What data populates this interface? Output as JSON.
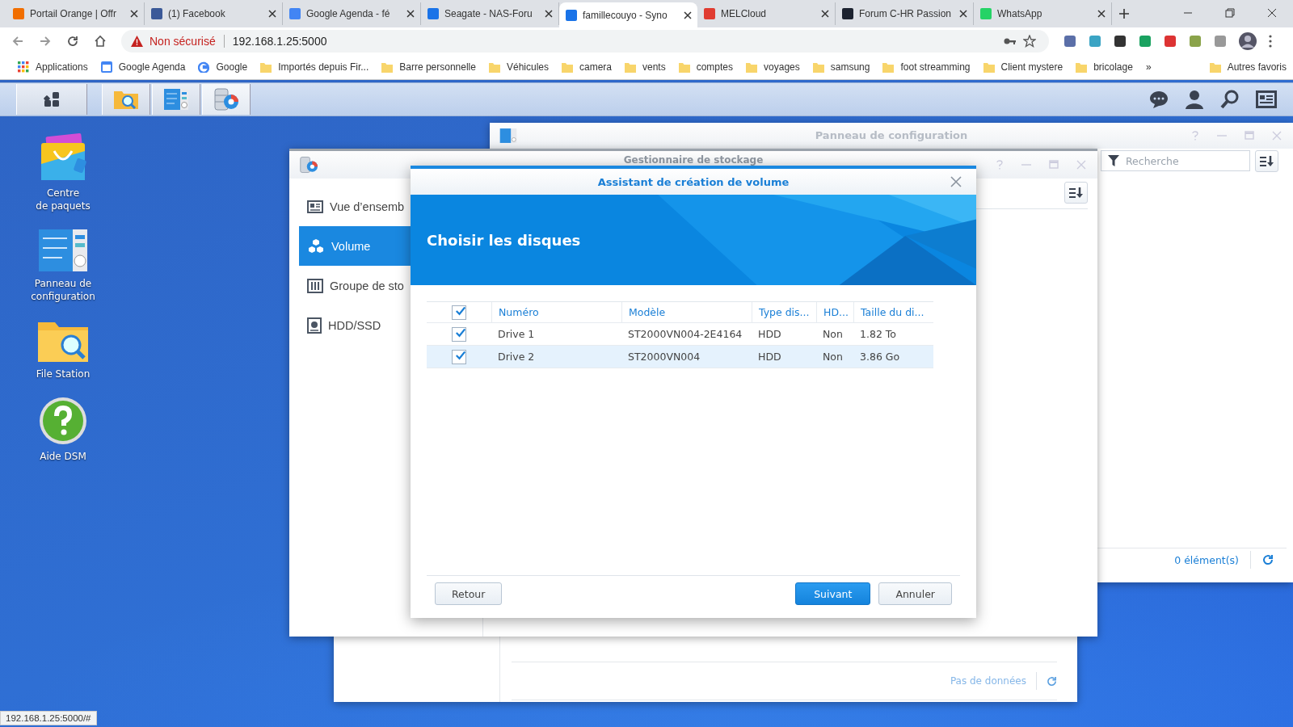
{
  "browser": {
    "tabs": [
      {
        "label": "Portail Orange | Offr",
        "selected": false
      },
      {
        "label": "(1) Facebook",
        "selected": false
      },
      {
        "label": "Google Agenda - fé",
        "selected": false
      },
      {
        "label": "Seagate - NAS-Foru",
        "selected": false
      },
      {
        "label": "famillecouyo - Syno",
        "selected": true
      },
      {
        "label": "MELCloud",
        "selected": false
      },
      {
        "label": "Forum C-HR Passion",
        "selected": false
      },
      {
        "label": "WhatsApp",
        "selected": false
      }
    ],
    "security": "Non sécurisé",
    "url": "192.168.1.25:5000",
    "bookmarks": [
      {
        "label": "Applications",
        "kind": "apps"
      },
      {
        "label": "Google Agenda",
        "kind": "calendar"
      },
      {
        "label": "Google",
        "kind": "google"
      },
      {
        "label": "Importés depuis Fir...",
        "kind": "folder"
      },
      {
        "label": "Barre personnelle",
        "kind": "folder"
      },
      {
        "label": "Véhicules",
        "kind": "folder"
      },
      {
        "label": "camera",
        "kind": "folder"
      },
      {
        "label": "vents",
        "kind": "folder"
      },
      {
        "label": "comptes",
        "kind": "folder"
      },
      {
        "label": "voyages",
        "kind": "folder"
      },
      {
        "label": "samsung",
        "kind": "folder"
      },
      {
        "label": "foot streamming",
        "kind": "folder"
      },
      {
        "label": "Client mystere",
        "kind": "folder"
      },
      {
        "label": "bricolage",
        "kind": "folder"
      },
      {
        "label": "»",
        "kind": "more"
      },
      {
        "label": "Autres favoris",
        "kind": "folder"
      }
    ],
    "status_url": "192.168.1.25:5000/#"
  },
  "desktop_icons": [
    {
      "label": "Centre\nde paquets"
    },
    {
      "label": "Panneau de\nconfiguration"
    },
    {
      "label": "File Station"
    },
    {
      "label": "Aide DSM"
    }
  ],
  "control_panel": {
    "title": "Panneau de configuration",
    "search": {
      "placeholder": "Recherche"
    },
    "count": "0 élément(s)"
  },
  "back_window": {
    "empty": "Pas de données"
  },
  "storage_manager": {
    "title": "Gestionnaire de stockage",
    "sidebar": [
      {
        "label": "Vue d’ensemb",
        "selected": false
      },
      {
        "label": "Volume",
        "selected": true
      },
      {
        "label": "Groupe de sto",
        "selected": false
      },
      {
        "label": "HDD/SSD",
        "selected": false
      }
    ]
  },
  "wizard": {
    "title": "Assistant de création de volume",
    "heading": "Choisir les disques",
    "all_checked": true,
    "columns": [
      "Numéro",
      "Modèle",
      "Type dis...",
      "HD...",
      "Taille du di..."
    ],
    "rows": [
      {
        "checked": true,
        "selected": false,
        "cells": [
          "Drive 1",
          "ST2000VN004-2E4164",
          "HDD",
          "Non",
          "1.82 To"
        ]
      },
      {
        "checked": true,
        "selected": true,
        "cells": [
          "Drive 2",
          "ST2000VN004",
          "HDD",
          "Non",
          "3.86 Go"
        ]
      }
    ],
    "buttons": {
      "back": "Retour",
      "next": "Suivant",
      "cancel": "Annuler"
    }
  }
}
